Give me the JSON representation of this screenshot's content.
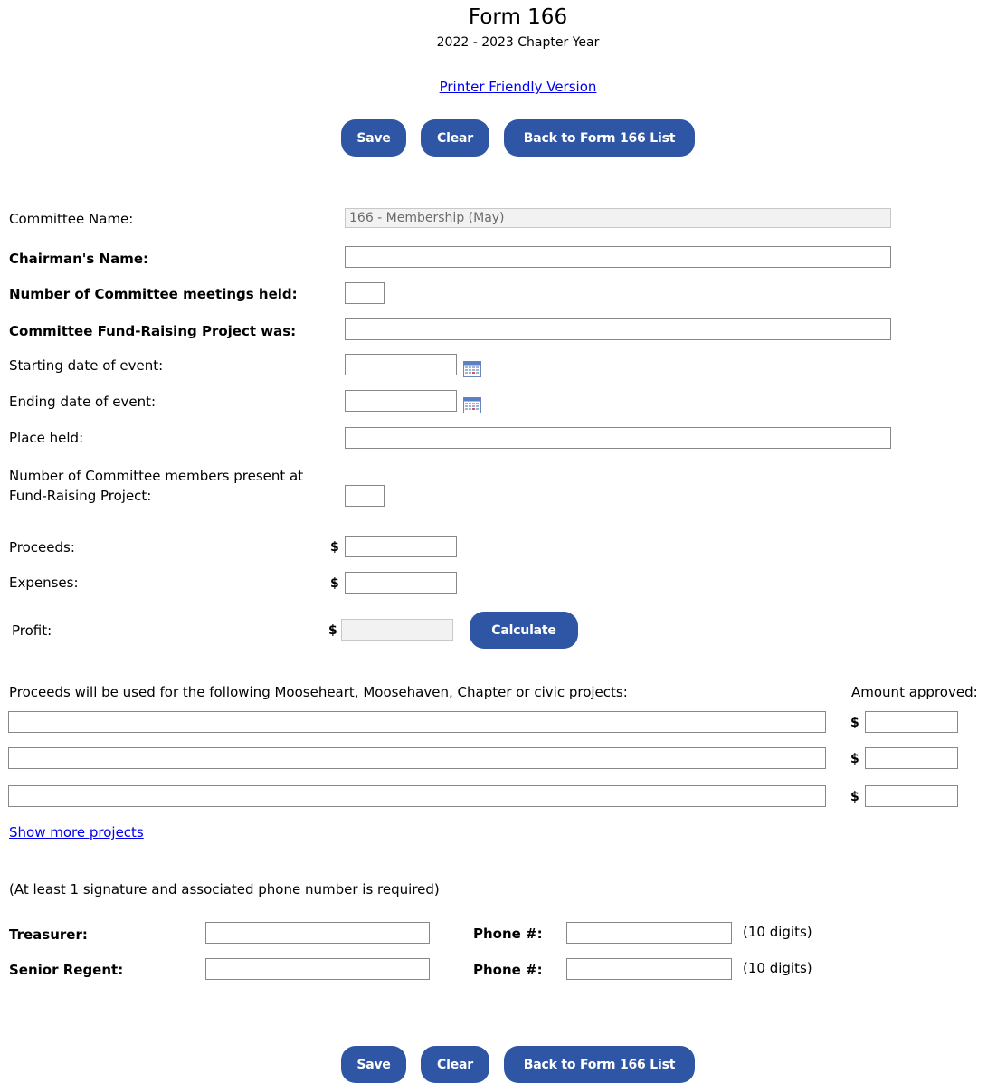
{
  "header": {
    "title": "Form 166",
    "subtitle": "2022 - 2023 Chapter Year",
    "printer_link": "Printer Friendly Version"
  },
  "buttons": {
    "save": "Save",
    "clear": "Clear",
    "back": "Back to Form 166 List",
    "calculate": "Calculate"
  },
  "form": {
    "committee_name_label": "Committee Name:",
    "committee_name_value": "166 - Membership (May)",
    "chairman_label": "Chairman's Name:",
    "meetings_label": "Number of Committee meetings held:",
    "project_label": "Committee Fund-Raising Project was:",
    "start_date_label": "Starting date of event:",
    "end_date_label": "Ending date of event:",
    "place_label": "Place held:",
    "members_present_label_1": "Number of Committee members present at",
    "members_present_label_2": "Fund-Raising Project:",
    "proceeds_label": "Proceeds:",
    "expenses_label": "Expenses:",
    "profit_label": "Profit:",
    "currency_symbol": "$"
  },
  "projects": {
    "label": "Proceeds will be used for the following Mooseheart, Moosehaven, Chapter or civic projects:",
    "amount_label": "Amount approved:",
    "show_more": "Show more projects",
    "rows": [
      {
        "description": "",
        "amount": ""
      },
      {
        "description": "",
        "amount": ""
      },
      {
        "description": "",
        "amount": ""
      }
    ]
  },
  "signatures": {
    "note": "(At least 1 signature and associated phone number is required)",
    "treasurer_label": "Treasurer:",
    "senior_regent_label": "Senior Regent:",
    "phone_label": "Phone #:",
    "phone_hint": "(10 digits)"
  },
  "colors": {
    "button_bg": "#2f56a5",
    "link": "#0000ee"
  },
  "icons": {
    "calendar": "calendar-icon"
  }
}
